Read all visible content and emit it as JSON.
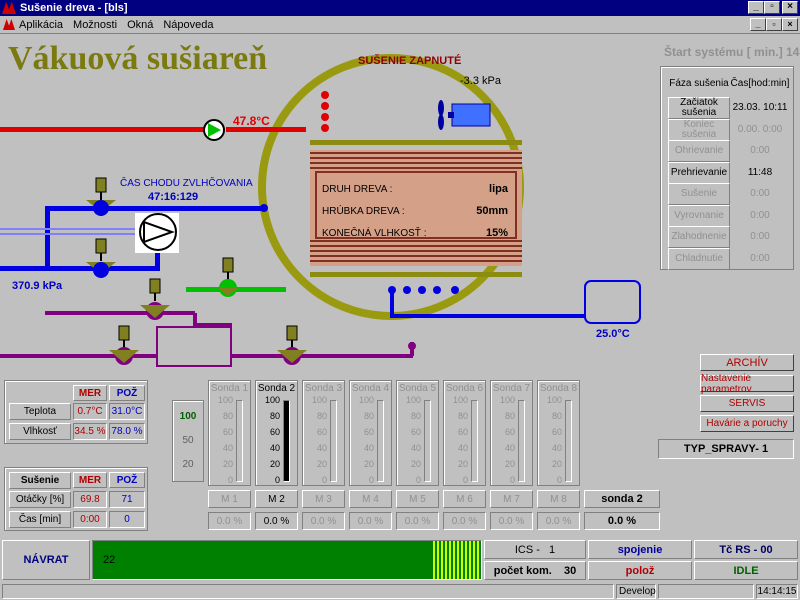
{
  "window": {
    "title": "Sušenie dreva - [bls]"
  },
  "menu": [
    "Aplikácia",
    "Možnosti",
    "Okná",
    "Nápoveda"
  ],
  "app_title": "Vákuová sušiareň",
  "start_system": "Štart systému [ min.]  14",
  "drying_status": "SUŠENIE ZAPNUTÉ",
  "pressure": "-3.3 kPa",
  "temp_top": "47.8°C",
  "humid_label": "ČAS CHODU ZVLHČOVANIA",
  "humid_time": "47:16:129",
  "pressure_left": "370.9 kPa",
  "temp_right": "25.0°C",
  "wood": {
    "rows": [
      {
        "label": "DRUH DREVA :",
        "value": "lipa"
      },
      {
        "label": "HRÚBKA DREVA :",
        "value": "50mm"
      },
      {
        "label": "KONEČNÁ VLHKOSŤ :",
        "value": "15%"
      }
    ]
  },
  "phases": {
    "header": [
      "Fáza sušenia",
      "Čas[hod:min]"
    ],
    "rows": [
      {
        "label": "Začiatok sušenia",
        "value": "23.03. 10:11",
        "active": true
      },
      {
        "label": "Koniec sušenia",
        "value": "0.00. 0:00",
        "active": false
      },
      {
        "label": "Ohrievanie",
        "value": "0:00",
        "active": false
      },
      {
        "label": "Prehrievanie",
        "value": "11:48",
        "active": true
      },
      {
        "label": "Sušenie",
        "value": "0:00",
        "active": false
      },
      {
        "label": "Vyrovnanie",
        "value": "0:00",
        "active": false
      },
      {
        "label": "Zlahodnenie",
        "value": "0:00",
        "active": false
      },
      {
        "label": "Chladnutie",
        "value": "0:00",
        "active": false
      }
    ]
  },
  "right_buttons": [
    "ARCHÍV",
    "Nastavenie parametrov",
    "SERVIS",
    "Havárie a poruchy"
  ],
  "typ_spravy": "TYP_SPRAVY-  1",
  "climate": {
    "headers": [
      "MER",
      "POŽ"
    ],
    "rows": [
      {
        "label": "Teplota",
        "mer": "0.7°C",
        "poz": "31.0°C"
      },
      {
        "label": "Vlhkosť",
        "mer": "34.5 %",
        "poz": "78.0 %"
      }
    ]
  },
  "drying": {
    "title": "Sušenie",
    "headers": [
      "MER",
      "POŽ"
    ],
    "rows": [
      {
        "label": "Otáčky [%]",
        "mer": "69.8",
        "poz": "71"
      },
      {
        "label": "Čas [min]",
        "mer": "0:00",
        "poz": "0"
      }
    ]
  },
  "scale_select": [
    "100",
    "50",
    "20"
  ],
  "sondy": [
    {
      "name": "Sonda 1",
      "m": "M 1",
      "pct": "0.0 %",
      "active": false
    },
    {
      "name": "Sonda 2",
      "m": "M 2",
      "pct": "0.0 %",
      "active": true
    },
    {
      "name": "Sonda 3",
      "m": "M 3",
      "pct": "0.0 %",
      "active": false
    },
    {
      "name": "Sonda 4",
      "m": "M 4",
      "pct": "0.0 %",
      "active": false
    },
    {
      "name": "Sonda 5",
      "m": "M 5",
      "pct": "0.0 %",
      "active": false
    },
    {
      "name": "Sonda 6",
      "m": "M 6",
      "pct": "0.0 %",
      "active": false
    },
    {
      "name": "Sonda 7",
      "m": "M 7",
      "pct": "0.0 %",
      "active": false
    },
    {
      "name": "Sonda 8",
      "m": "M 8",
      "pct": "0.0 %",
      "active": false
    }
  ],
  "sonda_scale": [
    "100",
    "80",
    "60",
    "40",
    "20",
    "0"
  ],
  "selected_sonda": {
    "name": "sonda  2",
    "value": "0.0 %"
  },
  "bottom": {
    "back": "NÁVRAT",
    "progress_value": "22",
    "ics_label": "ICS -",
    "ics_value": "1",
    "spojenie": "spojenie",
    "tc": "Tč RS - 00",
    "pocet_label": "počet kom.",
    "pocet_value": "30",
    "poloz": "polož",
    "idle": "IDLE"
  },
  "status": {
    "mode": "Develop",
    "time": "14:14:15"
  },
  "colors": {
    "olive": "#8c8c10",
    "pipe_red": "#e00000",
    "pipe_blue": "#0000e0",
    "pipe_purple": "#800080",
    "green_bar": "#008000"
  }
}
